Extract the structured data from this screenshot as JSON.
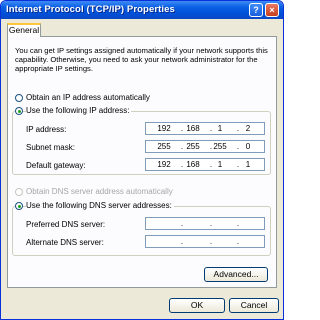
{
  "window": {
    "title": "Internet Protocol (TCP/IP) Properties",
    "help_label": "?",
    "close_label": "×"
  },
  "tabs": [
    {
      "label": "General"
    }
  ],
  "description": "You can get IP settings assigned automatically if your network supports this capability. Otherwise, you need to ask your network administrator for the appropriate IP settings.",
  "ip": {
    "auto_label": "Obtain an IP address automatically",
    "manual_label": "Use the following IP address:",
    "auto_selected": false,
    "manual_selected": true,
    "fields": [
      {
        "label": "IP address:",
        "octets": [
          "192",
          "168",
          "1",
          "2"
        ]
      },
      {
        "label": "Subnet mask:",
        "octets": [
          "255",
          "255",
          "255",
          "0"
        ]
      },
      {
        "label": "Default gateway:",
        "octets": [
          "192",
          "168",
          "1",
          "1"
        ]
      }
    ]
  },
  "dns": {
    "auto_label": "Obtain DNS server address automatically",
    "manual_label": "Use the following DNS server addresses:",
    "auto_enabled": false,
    "manual_selected": true,
    "fields": [
      {
        "label": "Preferred DNS server:",
        "octets": [
          "",
          "",
          "",
          ""
        ]
      },
      {
        "label": "Alternate DNS server:",
        "octets": [
          "",
          "",
          "",
          ""
        ]
      }
    ]
  },
  "buttons": {
    "advanced": "Advanced...",
    "ok": "OK",
    "cancel": "Cancel"
  }
}
